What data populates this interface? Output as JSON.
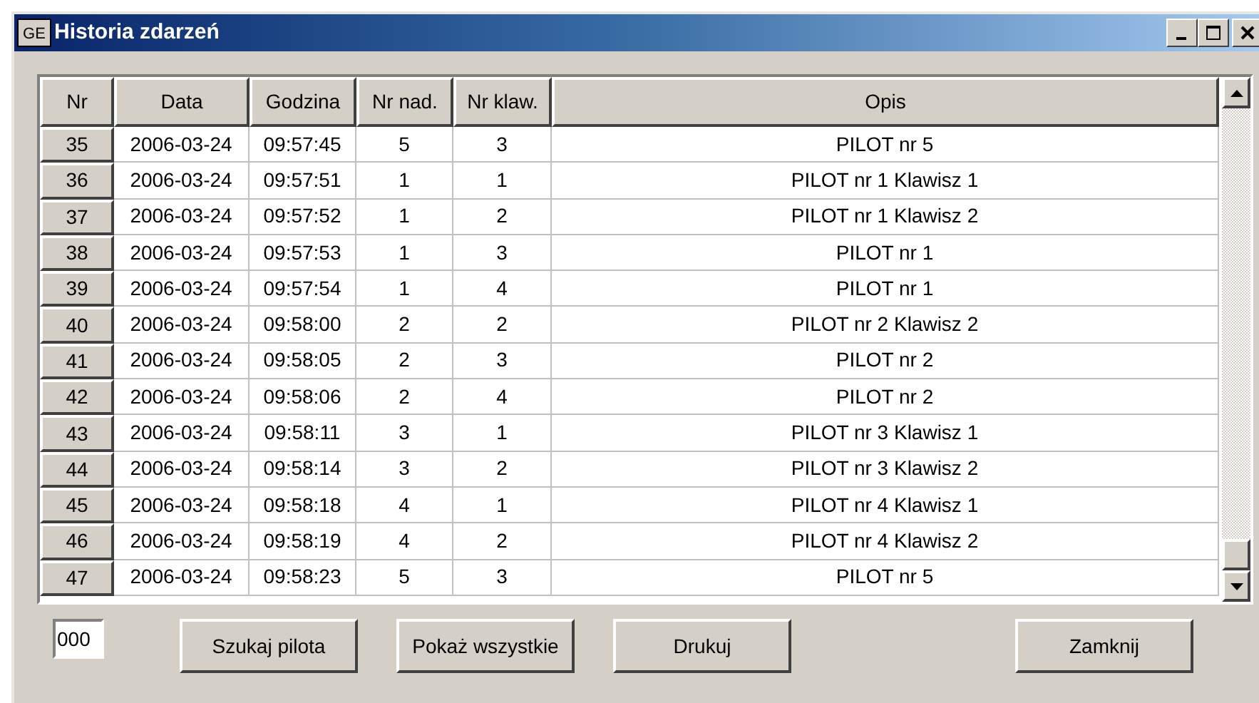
{
  "window": {
    "icon": "GE",
    "title": "Historia zdarzeń"
  },
  "table": {
    "columns": [
      "Nr",
      "Data",
      "Godzina",
      "Nr nad.",
      "Nr klaw.",
      "Opis"
    ],
    "rows": [
      [
        "35",
        "2006-03-24",
        "09:57:45",
        "5",
        "3",
        "PILOT nr 5"
      ],
      [
        "36",
        "2006-03-24",
        "09:57:51",
        "1",
        "1",
        "PILOT nr 1 Klawisz 1"
      ],
      [
        "37",
        "2006-03-24",
        "09:57:52",
        "1",
        "2",
        "PILOT nr 1 Klawisz 2"
      ],
      [
        "38",
        "2006-03-24",
        "09:57:53",
        "1",
        "3",
        "PILOT nr 1"
      ],
      [
        "39",
        "2006-03-24",
        "09:57:54",
        "1",
        "4",
        "PILOT nr 1"
      ],
      [
        "40",
        "2006-03-24",
        "09:58:00",
        "2",
        "2",
        "PILOT nr 2 Klawisz 2"
      ],
      [
        "41",
        "2006-03-24",
        "09:58:05",
        "2",
        "3",
        "PILOT nr 2"
      ],
      [
        "42",
        "2006-03-24",
        "09:58:06",
        "2",
        "4",
        "PILOT nr 2"
      ],
      [
        "43",
        "2006-03-24",
        "09:58:11",
        "3",
        "1",
        "PILOT nr 3 Klawisz 1"
      ],
      [
        "44",
        "2006-03-24",
        "09:58:14",
        "3",
        "2",
        "PILOT nr 3 Klawisz 2"
      ],
      [
        "45",
        "2006-03-24",
        "09:58:18",
        "4",
        "1",
        "PILOT nr 4 Klawisz 1"
      ],
      [
        "46",
        "2006-03-24",
        "09:58:19",
        "4",
        "2",
        "PILOT nr 4 Klawisz 2"
      ],
      [
        "47",
        "2006-03-24",
        "09:58:23",
        "5",
        "3",
        "PILOT nr 5"
      ]
    ]
  },
  "pilot_field": {
    "value": "000"
  },
  "buttons": [
    "Szukaj pilota",
    "Pokaż wszystkie",
    "Drukuj",
    "Zamknij"
  ]
}
